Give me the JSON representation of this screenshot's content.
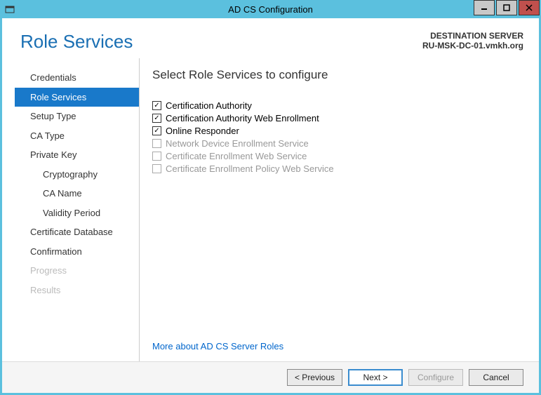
{
  "window": {
    "title": "AD CS Configuration"
  },
  "header": {
    "page_title": "Role Services",
    "dest_label": "DESTINATION SERVER",
    "dest_value": "RU-MSK-DC-01.vmkh.org"
  },
  "sidebar": {
    "items": [
      {
        "label": "Credentials",
        "active": false,
        "disabled": false,
        "sub": false
      },
      {
        "label": "Role Services",
        "active": true,
        "disabled": false,
        "sub": false
      },
      {
        "label": "Setup Type",
        "active": false,
        "disabled": false,
        "sub": false
      },
      {
        "label": "CA Type",
        "active": false,
        "disabled": false,
        "sub": false
      },
      {
        "label": "Private Key",
        "active": false,
        "disabled": false,
        "sub": false
      },
      {
        "label": "Cryptography",
        "active": false,
        "disabled": false,
        "sub": true
      },
      {
        "label": "CA Name",
        "active": false,
        "disabled": false,
        "sub": true
      },
      {
        "label": "Validity Period",
        "active": false,
        "disabled": false,
        "sub": true
      },
      {
        "label": "Certificate Database",
        "active": false,
        "disabled": false,
        "sub": false
      },
      {
        "label": "Confirmation",
        "active": false,
        "disabled": false,
        "sub": false
      },
      {
        "label": "Progress",
        "active": false,
        "disabled": true,
        "sub": false
      },
      {
        "label": "Results",
        "active": false,
        "disabled": true,
        "sub": false
      }
    ]
  },
  "detail": {
    "heading": "Select Role Services to configure",
    "options": [
      {
        "label": "Certification Authority",
        "checked": true,
        "disabled": false
      },
      {
        "label": "Certification Authority Web Enrollment",
        "checked": true,
        "disabled": false
      },
      {
        "label": "Online Responder",
        "checked": true,
        "disabled": false
      },
      {
        "label": "Network Device Enrollment Service",
        "checked": false,
        "disabled": true
      },
      {
        "label": "Certificate Enrollment Web Service",
        "checked": false,
        "disabled": true
      },
      {
        "label": "Certificate Enrollment Policy Web Service",
        "checked": false,
        "disabled": true
      }
    ],
    "more_link": "More about AD CS Server Roles"
  },
  "footer": {
    "previous": "< Previous",
    "next": "Next >",
    "configure": "Configure",
    "cancel": "Cancel"
  }
}
